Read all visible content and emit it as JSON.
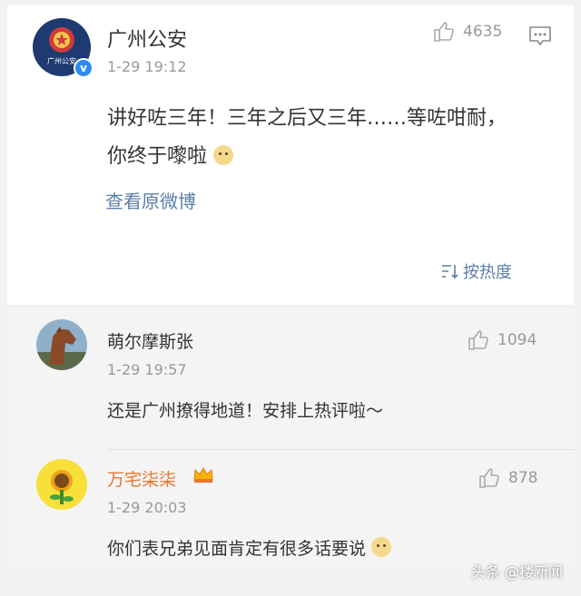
{
  "post": {
    "author": "广州公安",
    "avatar_text": "广州公安",
    "time": "1-29 19:12",
    "likes": "4635",
    "content": "讲好咗三年！三年之后又三年……等咗咁耐，你终于嚟啦",
    "view_original": "查看原微博",
    "sort_label": "按热度"
  },
  "comments": [
    {
      "author": "萌尔摩斯张",
      "time": "1-29 19:57",
      "likes": "1094",
      "text": "还是广州撩得地道！安排上热评啦～"
    },
    {
      "author": "万宅柒柒",
      "time": "1-29 20:03",
      "likes": "878",
      "text": "你们表兄弟见面肯定有很多话要说"
    }
  ],
  "watermark": "头条 @楼新闻",
  "colors": {
    "link": "#5b7fa8",
    "vip_name": "#e8772e",
    "muted": "#999999",
    "verify": "#2d8cf0"
  }
}
